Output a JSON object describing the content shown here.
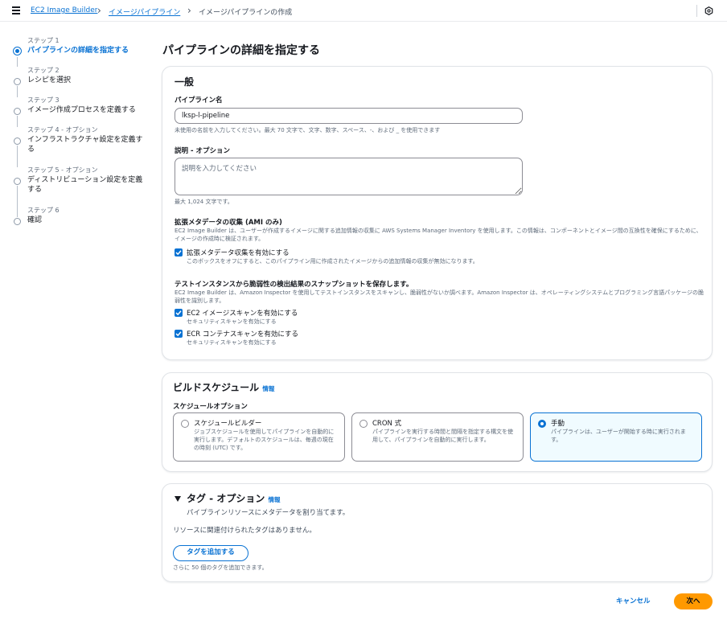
{
  "breadcrumb": {
    "items": [
      "EC2 Image Builder",
      "イメージパイプライン"
    ],
    "current": "イメージパイプラインの作成"
  },
  "steps": [
    {
      "num": "ステップ 1",
      "title": "パイプラインの詳細を指定する",
      "active": true
    },
    {
      "num": "ステップ 2",
      "title": "レシピを選択"
    },
    {
      "num": "ステップ 3",
      "title": "イメージ作成プロセスを定義する"
    },
    {
      "num": "ステップ 4 - オプション",
      "title": "インフラストラクチャ設定を定義する"
    },
    {
      "num": "ステップ 5 - オプション",
      "title": "ディストリビューション設定を定義する"
    },
    {
      "num": "ステップ 6",
      "title": "確認"
    }
  ],
  "page_title": "パイプラインの詳細を指定する",
  "general": {
    "title": "一般",
    "name_label": "パイプライン名",
    "name_value": "lksp-l-pipeline",
    "name_help": "未使用の名前を入力してください。最大 70 文字で、文字、数字、スペース、-、および _ を使用できます",
    "desc_label": "説明 - オプション",
    "desc_placeholder": "説明を入力してください",
    "desc_help": "最大 1,024 文字です。",
    "metadata_title": "拡張メタデータの収集 (AMI のみ)",
    "metadata_desc": "EC2 Image Builder は、ユーザーが作成するイメージに関する追加情報の収集に AWS Systems Manager Inventory を使用します。この情報は、コンポーネントとイメージ間の互換性を確保にするために、イメージの作成時に検証されます。",
    "metadata_cb_label": "拡張メタデータ収集を有効にする",
    "metadata_cb_desc": "このボックスをオフにすると、このパイプライン用に作成されたイメージからの追加情報の収集が無効になります。",
    "snapshot_title": "テストインスタンスから脆弱性の検出結果のスナップショットを保存します。",
    "snapshot_desc": "EC2 Image Builder は、Amazon Inspector を使用してテストインスタンスをスキャンし、脆弱性がないか調べます。Amazon Inspector は、オペレーティングシステムとプログラミング言語パッケージの脆弱性を識別します。",
    "ec2_scan_label": "EC2 イメージスキャンを有効にする",
    "ec2_scan_desc": "セキュリティスキャンを有効にする",
    "ecr_scan_label": "ECR コンテナスキャンを有効にする",
    "ecr_scan_desc": "セキュリティスキャンを有効にする"
  },
  "schedule": {
    "title": "ビルドスケジュール",
    "info": "情報",
    "options_label": "スケジュールオプション",
    "options": [
      {
        "title": "スケジュールビルダー",
        "desc": "ジョブスケジュールを使用してパイプラインを自動的に実行します。デフォルトのスケジュールは、毎週の現在の時刻 (UTC) です。",
        "selected": false
      },
      {
        "title": "CRON 式",
        "desc": "パイプラインを実行する時間と間隔を指定する構文を使用して、パイプラインを自動的に実行します。",
        "selected": false
      },
      {
        "title": "手動",
        "desc": "パイプラインは、ユーザーが開始する時に実行されます。",
        "selected": true
      }
    ]
  },
  "tags": {
    "title": "タグ - オプション",
    "info": "情報",
    "subtitle": "パイプラインリソースにメタデータを割り当てます。",
    "empty": "リソースに関連付けられたタグはありません。",
    "add_button": "タグを追加する",
    "remaining": "さらに 50 個のタグを追加できます。"
  },
  "footer": {
    "cancel": "キャンセル",
    "next": "次へ"
  },
  "colors": {
    "link": "#0972d3",
    "primary": "#ff9900",
    "selected_tile_bg": "#f0fbff"
  }
}
